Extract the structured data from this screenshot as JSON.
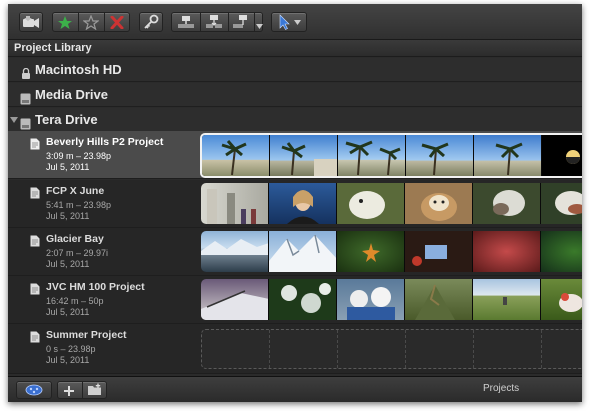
{
  "toolbar": {
    "buttons": [
      {
        "icon": "import-media-icon"
      },
      {
        "icon": "favorite-star-icon",
        "color": "#3cb04a"
      },
      {
        "icon": "unrate-star-icon"
      },
      {
        "icon": "reject-x-icon",
        "color": "#cc3333"
      },
      {
        "icon": "keyword-key-icon"
      },
      {
        "icon": "connect-clip-icon"
      },
      {
        "icon": "insert-clip-icon"
      },
      {
        "icon": "append-clip-icon"
      },
      {
        "icon": "select-tool-icon",
        "color": "#3a78d6"
      }
    ]
  },
  "library": {
    "title": "Project Library",
    "drives": [
      {
        "name": "Macintosh HD",
        "icon": "lock-drive-icon"
      },
      {
        "name": "Media Drive",
        "icon": "drive-icon"
      },
      {
        "name": "Tera Drive",
        "icon": "drive-icon",
        "expanded": true
      }
    ],
    "projects": [
      {
        "name": "Beverly Hills P2 Project",
        "meta": "3:09 m – 23.98p",
        "date": "Jul 5, 2011",
        "selected": true
      },
      {
        "name": "FCP X June",
        "meta": "5:41 m – 23.98p",
        "date": "Jul 5, 2011"
      },
      {
        "name": "Glacier Bay",
        "meta": "2:07 m – 29.97i",
        "date": "Jul 5, 2011"
      },
      {
        "name": "JVC HM 100 Project",
        "meta": "16:42 m – 50p",
        "date": "Jul 5, 2011"
      },
      {
        "name": "Summer Project",
        "meta": "0 s – 23.98p",
        "date": "Jul 5, 2011",
        "empty": true
      }
    ]
  },
  "bottom": {
    "label": "Projects"
  }
}
